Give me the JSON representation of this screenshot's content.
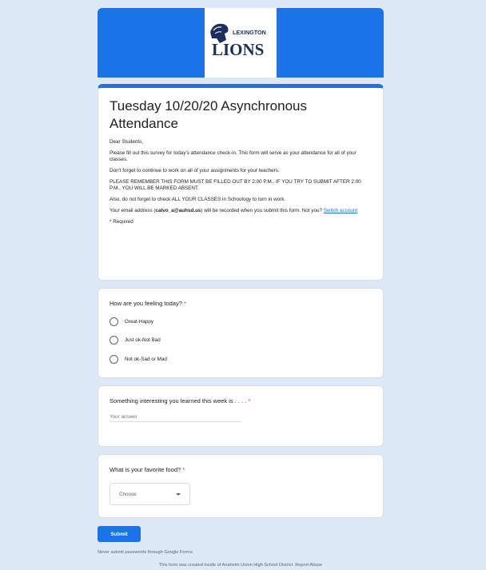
{
  "header": {
    "logo_top": "LEXINGTON",
    "logo_bottom": "LIONS"
  },
  "form": {
    "title": "Tuesday 10/20/20 Asynchronous Attendance",
    "greeting": "Dear Students,",
    "para1": "Please fill out this survey for today's attendance check-in.  This form will serve as your attendance for all of your classes.",
    "para2": "Don't forget to continue to work on all of your assignments for your teachers.",
    "para3": "PLEASE REMEMBER THIS FORM MUST BE FILLED OUT BY 2:00 P.M..  IF YOU TRY TO SUBMIT AFTER 2:00 P.M., YOU WILL BE MARKED ABSENT.",
    "para4": "Also, do not forget to check ALL YOUR CLASSES in Schoology to turn in work.",
    "email_prefix": "Your email address (",
    "email": "calvo_a@auhsd.us",
    "email_suffix": ") will be recorded when you submit this form. Not you?",
    "switch_account": "Switch account",
    "required_note": "* Required"
  },
  "q1": {
    "title": "How are you feeling today?",
    "star": "*",
    "options": [
      "Great-Happy",
      "Just ok-Not Bad",
      "Not ok-Sad or Mad"
    ]
  },
  "q2": {
    "title": "Something interesting you learned this week is . . . .",
    "star": "*",
    "placeholder": "Your answer"
  },
  "q3": {
    "title": "What is your favorite food?",
    "star": "*",
    "dropdown": "Choose"
  },
  "submit_label": "Submit",
  "warning": "Never submit passwords through Google Forms.",
  "footer": {
    "created": "This form was created inside of Anaheim Union High School District.",
    "report": "Report Abuse"
  },
  "colors": {
    "accent": "#1a73e8",
    "background": "#dde9f7",
    "required": "#d93025"
  }
}
